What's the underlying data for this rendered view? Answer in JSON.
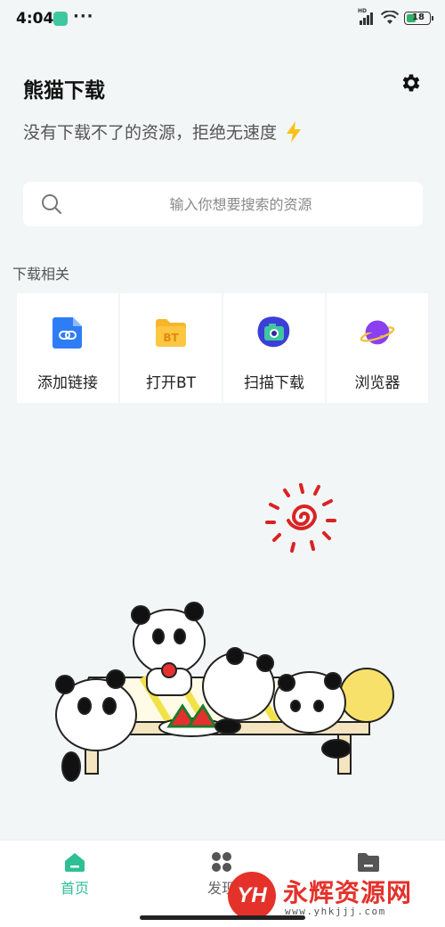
{
  "status_bar": {
    "time": "4:04",
    "dots": "···",
    "battery": "18",
    "network": "HD"
  },
  "header": {
    "title": "熊猫下载",
    "slogan": "没有下载不了的资源，拒绝无速度",
    "settings_icon": "gear-icon",
    "slogan_icon": "lightning-icon"
  },
  "search": {
    "placeholder": "输入你想要搜索的资源",
    "value": ""
  },
  "download_section": {
    "title": "下载相关",
    "tools": [
      {
        "label": "添加链接",
        "icon": "link-icon",
        "color": "#2f7df6"
      },
      {
        "label": "打开BT",
        "icon": "bt-folder-icon",
        "color": "#f7b52c"
      },
      {
        "label": "扫描下载",
        "icon": "camera-icon",
        "color": "#3b3fd8"
      },
      {
        "label": "浏览器",
        "icon": "planet-icon",
        "color": "#8a3ff0"
      }
    ]
  },
  "bottom_nav": {
    "items": [
      {
        "label": "首页",
        "icon": "home-icon",
        "active": true
      },
      {
        "label": "发现",
        "icon": "discover-icon",
        "active": false
      },
      {
        "label": "",
        "icon": "folder-icon",
        "active": false
      }
    ]
  },
  "watermark": {
    "logo": "YH",
    "text": "永辉资源网",
    "url": "www.yhkjjj.com"
  },
  "colors": {
    "accent": "#2fbf95",
    "background": "#f2f6f6"
  }
}
